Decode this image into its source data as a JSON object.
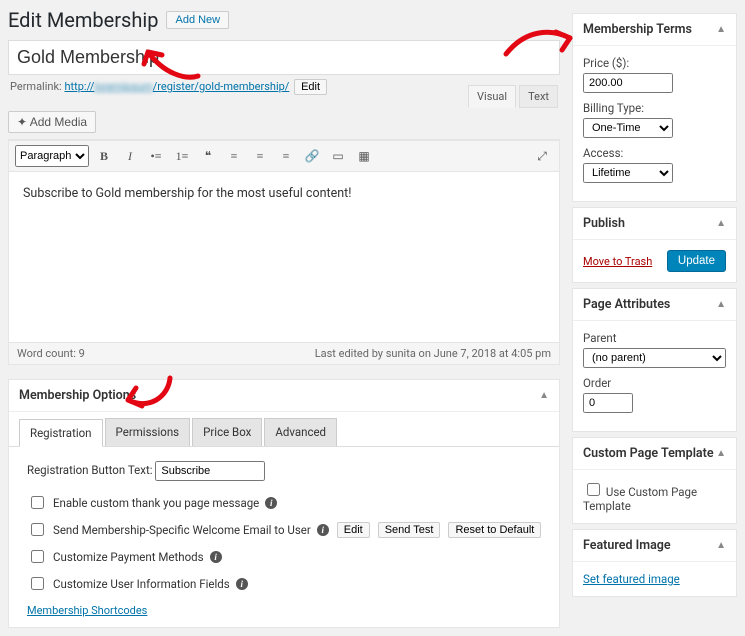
{
  "header": {
    "heading": "Edit Membership",
    "add_new": "Add New"
  },
  "title_value": "Gold Membership",
  "permalink": {
    "label": "Permalink:",
    "url_prefix": "http://",
    "url_rest": "/register/gold-membership/",
    "edit": "Edit"
  },
  "media_button": "Add Media",
  "editor_tabs": {
    "visual": "Visual",
    "text": "Text"
  },
  "paragraph_select": "Paragraph",
  "editor_content": "Subscribe to Gold membership for the most useful content!",
  "footer": {
    "word_count": "Word count: 9",
    "last_edited": "Last edited by sunita on June 7, 2018 at 4:05 pm"
  },
  "options": {
    "title": "Membership Options",
    "tabs": [
      "Registration",
      "Permissions",
      "Price Box",
      "Advanced"
    ],
    "registration": {
      "reg_btn_label": "Registration Button Text:",
      "reg_btn_value": "Subscribe",
      "cb_thankyou": "Enable custom thank you page message",
      "cb_welcome": "Send Membership-Specific Welcome Email to User",
      "btn_edit": "Edit",
      "btn_sendtest": "Send Test",
      "btn_reset": "Reset to Default",
      "cb_payment": "Customize Payment Methods",
      "cb_userinfo": "Customize User Information Fields",
      "shortcodes": "Membership Shortcodes"
    }
  },
  "terms": {
    "title": "Membership Terms",
    "price_label": "Price ($):",
    "price_value": "200.00",
    "billing_label": "Billing Type:",
    "billing_value": "One-Time",
    "access_label": "Access:",
    "access_value": "Lifetime"
  },
  "publish": {
    "title": "Publish",
    "trash": "Move to Trash",
    "update": "Update"
  },
  "page_attrs": {
    "title": "Page Attributes",
    "parent_label": "Parent",
    "parent_value": "(no parent)",
    "order_label": "Order",
    "order_value": "0"
  },
  "custom_template": {
    "title": "Custom Page Template",
    "cb_label": "Use Custom Page Template"
  },
  "featured": {
    "title": "Featured Image",
    "link": "Set featured image"
  }
}
